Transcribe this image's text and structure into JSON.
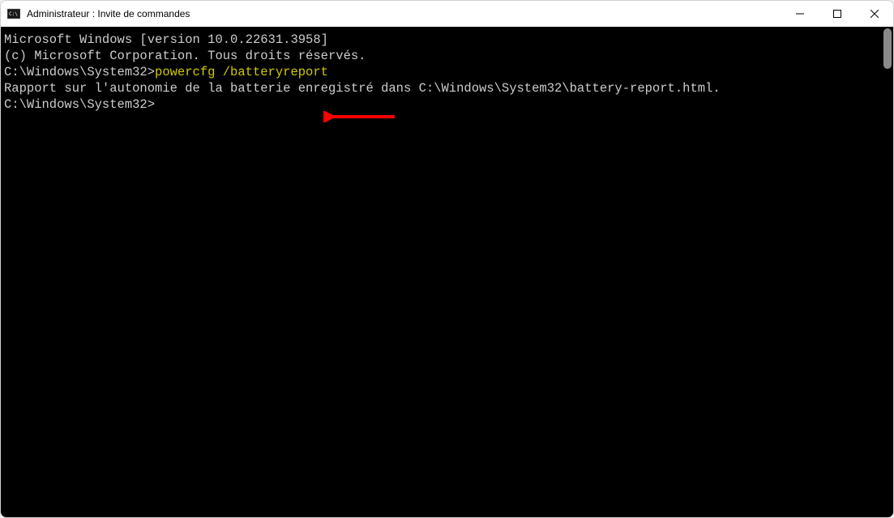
{
  "window": {
    "title": "Administrateur : Invite de commandes"
  },
  "terminal": {
    "line1": "Microsoft Windows [version 10.0.22631.3958]",
    "line2": "(c) Microsoft Corporation. Tous droits réservés.",
    "blank1": "",
    "prompt1": "C:\\Windows\\System32>",
    "command1": "powercfg /batteryreport",
    "output1": "Rapport sur l'autonomie de la batterie enregistré dans C:\\Windows\\System32\\battery-report.html.",
    "blank2": "",
    "prompt2": "C:\\Windows\\System32>"
  },
  "colors": {
    "command": "#d2c800",
    "text": "#cccccc",
    "background": "#000000",
    "arrow": "#ff0000"
  }
}
